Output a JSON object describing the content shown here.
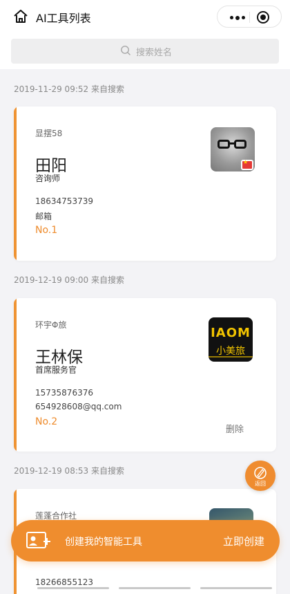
{
  "header": {
    "title": "AI工具列表",
    "home_icon": "home-icon",
    "more_icon": "more-dots-icon",
    "close_icon": "target-close-icon"
  },
  "search": {
    "placeholder": "搜索姓名",
    "icon": "search-icon"
  },
  "entries": [
    {
      "date_label": "2019-11-29 09:52 来自搜索",
      "company": "显摆58",
      "name": "田阳",
      "role": "咨询师",
      "phone": "18634753739",
      "email": "邮箱",
      "rank": "No.1",
      "avatar": "boy-with-glasses-photo",
      "badge": "china-flag-icon"
    },
    {
      "date_label": "2019-12-19 09:00 来自搜索",
      "company": "环宇Φ旅",
      "name": "王林保",
      "role": "首席服务官",
      "phone": "15735876376",
      "email": "654928608@qq.com",
      "rank": "No.2",
      "delete_label": "删除",
      "avatar": "xiaomei-travel-logo",
      "logo_text": "IAOM",
      "logo_cn": "小美旅"
    },
    {
      "date_label": "2019-12-19 08:53 来自搜索",
      "company": "莲蓬合作社",
      "name": "",
      "phone": "18266855123",
      "avatar": "landscape-photo"
    }
  ],
  "fab": {
    "label": "返回",
    "icon": "compass-edit-icon"
  },
  "bottom_bar": {
    "text": "创建我的智能工具",
    "button": "立即创建",
    "icon": "business-card-icon"
  },
  "colors": {
    "accent": "#ef9333",
    "background": "#f3f3f6"
  }
}
